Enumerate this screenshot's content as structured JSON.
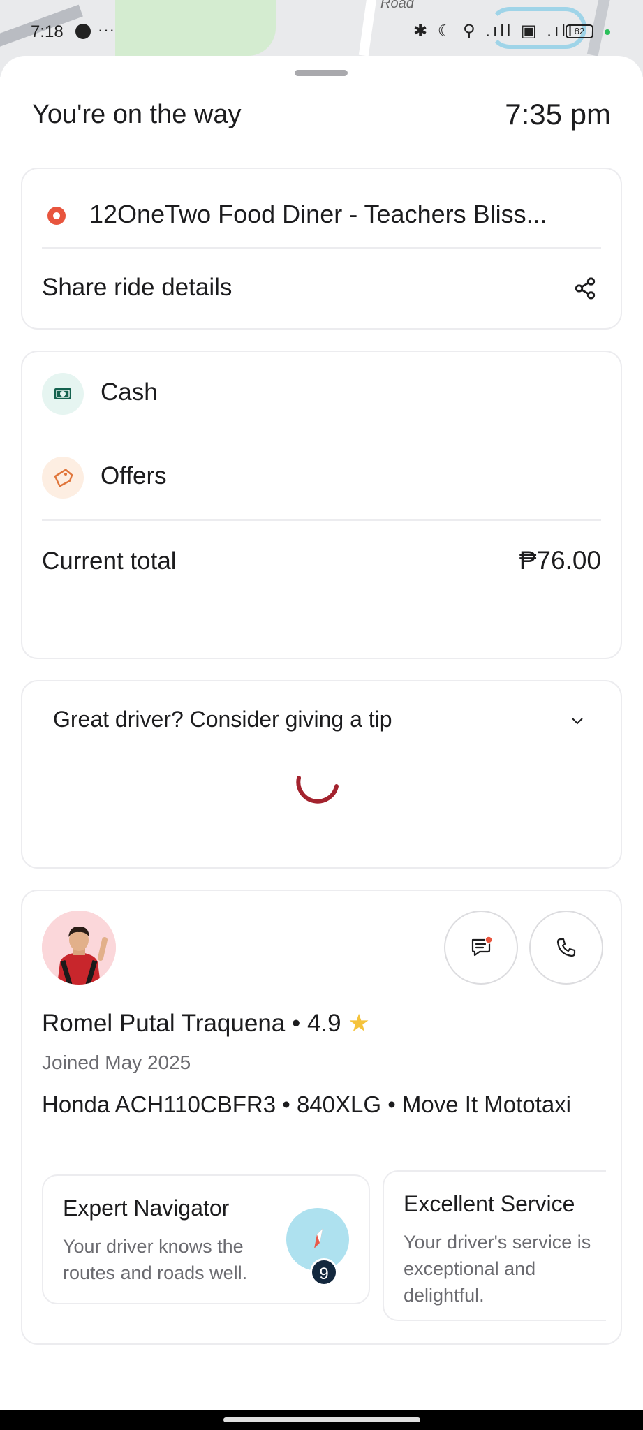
{
  "map": {
    "road_label": "Road"
  },
  "status_bar": {
    "time": "7:18",
    "more": "···",
    "icons": "✱ ☾ ⚲ .ıll ▣ .ıll",
    "battery": "82"
  },
  "header": {
    "title": "You're on the way",
    "eta": "7:35 pm"
  },
  "destination": {
    "name": "12OneTwo Food Diner - Teachers Bliss...",
    "share_label": "Share ride details"
  },
  "payment": {
    "method_label": "Cash",
    "offers_label": "Offers",
    "total_label": "Current total",
    "total_value": "₱76.00"
  },
  "tip": {
    "title": "Great driver? Consider giving a tip"
  },
  "driver": {
    "name": "Romel Putal Traquena",
    "separator": " • ",
    "rating": "4.9",
    "star": "★",
    "joined": "Joined May 2025",
    "vehicle": "Honda ACH110CBFR3 • 840XLG • Move It Mototaxi"
  },
  "badges": [
    {
      "title": "Expert Navigator",
      "description": "Your driver knows the routes and roads well.",
      "count": "9"
    },
    {
      "title": "Excellent Service",
      "description": "Your driver's service is exceptional and delightful."
    }
  ],
  "colors": {
    "accent_red": "#e8553e",
    "spinner": "#a3232e",
    "star": "#f5c33b",
    "cash_bg": "#e6f5f1",
    "offer_bg": "#fdeee2"
  }
}
